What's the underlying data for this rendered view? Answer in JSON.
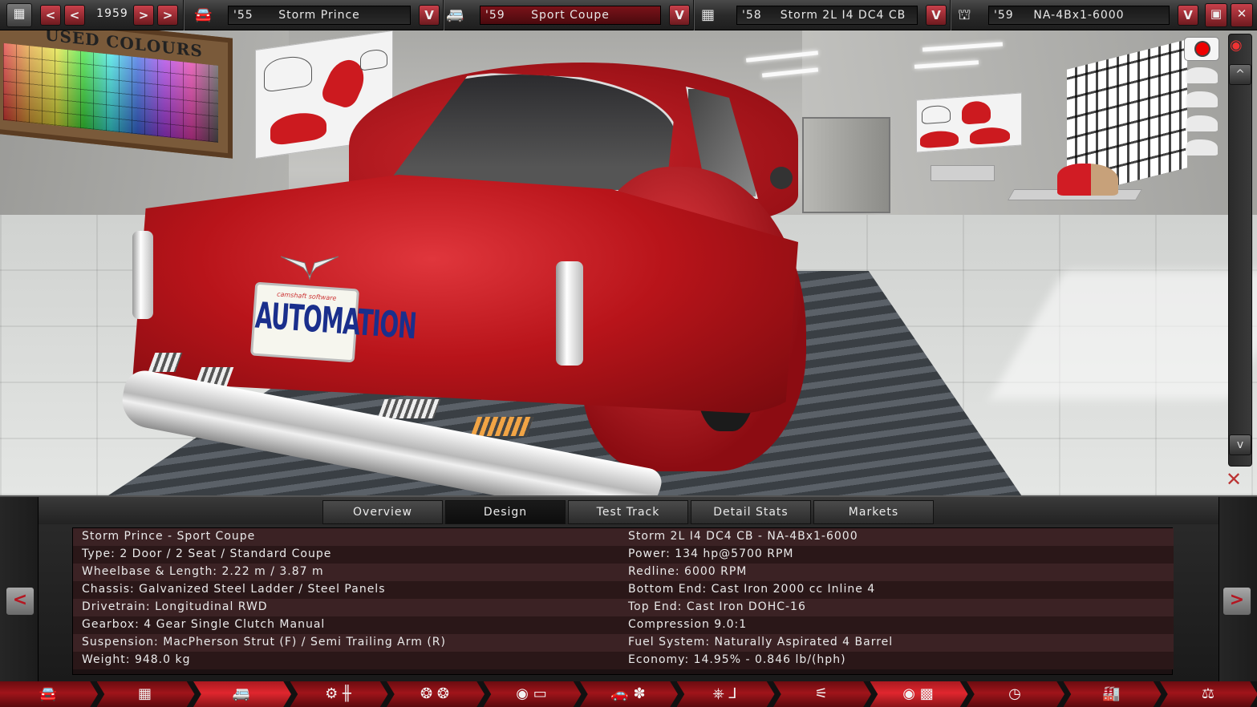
{
  "toolbar": {
    "calendar_icon": "calendar-icon",
    "year": "1959",
    "model": {
      "year": "'55",
      "name": "Storm Prince"
    },
    "trim": {
      "year": "'59",
      "name": "Sport Coupe"
    },
    "engine": {
      "year": "'58",
      "name": "Storm 2L I4 DC4 CB"
    },
    "engine_variant": {
      "year": "'59",
      "name": "NA-4Bx1-6000"
    },
    "dropdown_glyph": "V",
    "prev_glyph": "<",
    "next_glyph": ">",
    "close_glyph": "✕"
  },
  "scene": {
    "board_title": "USED COLOURS",
    "plate_text": "AUTOMATION",
    "plate_top": "camshaft software",
    "scroll_up": "^",
    "scroll_down": "v"
  },
  "tabs": [
    {
      "label": "Overview",
      "active": false
    },
    {
      "label": "Design",
      "active": true
    },
    {
      "label": "Test Track",
      "active": false
    },
    {
      "label": "Detail Stats",
      "active": false
    },
    {
      "label": "Markets",
      "active": false
    }
  ],
  "info": {
    "left": [
      "Storm Prince - Sport Coupe",
      "Type: 2 Door / 2 Seat / Standard Coupe",
      "Wheelbase & Length: 2.22 m / 3.87 m",
      "Chassis: Galvanized Steel Ladder / Steel Panels",
      "Drivetrain: Longitudinal RWD",
      "Gearbox: 4 Gear Single Clutch Manual",
      "Suspension: MacPherson Strut (F) / Semi Trailing Arm (R)",
      "Weight: 948.0 kg"
    ],
    "right": [
      "Storm 2L I4 DC4 CB - NA-4Bx1-6000",
      "Power: 134 hp@5700 RPM",
      "Redline: 6000 RPM",
      "Bottom End: Cast Iron 2000 cc Inline 4",
      "Top End: Cast Iron DOHC-16",
      "Compression 9.0:1",
      "Fuel System: Naturally Aspirated 4 Barrel",
      "Economy: 14.95% - 0.846 lb/(hph)"
    ]
  },
  "panel_nav": {
    "prev": "<",
    "next": ">"
  },
  "navbar": [
    {
      "icon": "car-model-icon",
      "glyph": "🚘",
      "active": false
    },
    {
      "icon": "chassis-icon",
      "glyph": "▦",
      "active": false
    },
    {
      "icon": "trim-icon",
      "glyph": "🚐",
      "active": true
    },
    {
      "icon": "suspension-icon",
      "glyph": "⚙ ╫",
      "active": false
    },
    {
      "icon": "wheels-icon",
      "glyph": "❂ ❂",
      "active": false
    },
    {
      "icon": "body-design-icon",
      "glyph": "◉ ▭",
      "active": false
    },
    {
      "icon": "aero-fixtures-icon",
      "glyph": "🚗 ✽",
      "active": false
    },
    {
      "icon": "interior-icon",
      "glyph": "⎈ ⅃",
      "active": false
    },
    {
      "icon": "exhaust-icon",
      "glyph": "⚟",
      "active": false
    },
    {
      "icon": "test-track-icon",
      "glyph": "◉ ▩",
      "active": true
    },
    {
      "icon": "engineering-time-icon",
      "glyph": "◷",
      "active": false
    },
    {
      "icon": "factory-icon",
      "glyph": "🏭",
      "active": false
    },
    {
      "icon": "balance-icon",
      "glyph": "⚖",
      "active": false
    }
  ],
  "colors": {
    "accent_red": "#a0141a",
    "panel_row_odd": "#3b2224",
    "panel_row_even": "#2a1718"
  }
}
